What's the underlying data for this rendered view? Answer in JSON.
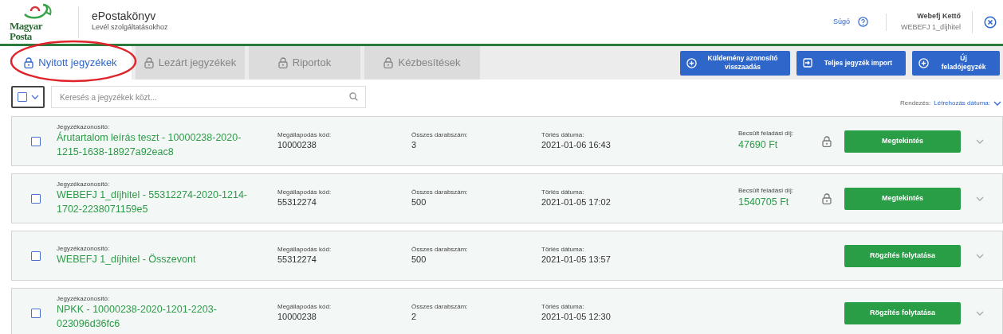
{
  "header": {
    "logo_text": "Magyar Posta",
    "app_title": "ePostakönyv",
    "app_subtitle": "Levél szolgáltatásokhoz",
    "help_label": "Súgó",
    "user_name": "Webefj Kettő",
    "user_account": "WEBEFJ 1_díjhitel"
  },
  "tabs": [
    {
      "label": "Nyitott jegyzékek",
      "selected": true,
      "disabled": false
    },
    {
      "label": "Lezárt jegyzékek",
      "selected": false,
      "disabled": true
    },
    {
      "label": "Riportok",
      "selected": false,
      "disabled": true
    },
    {
      "label": "Kézbesítések",
      "selected": false,
      "disabled": true
    }
  ],
  "actions": [
    {
      "label": "Küldemény azonosító visszaadás",
      "kind": "add"
    },
    {
      "label": "Teljes jegyzék import",
      "kind": "import"
    },
    {
      "label": "Új feladójegyzék",
      "kind": "add"
    }
  ],
  "toolbar": {
    "select_all_checked": false,
    "search_placeholder": "Keresés a jegyzékek közt...",
    "sort_label": "Rendezés:",
    "sort_value": "Létrehozás dátuma:"
  },
  "rows": [
    {
      "checked": false,
      "id_label": "Jegyzékazonosító:",
      "id": "Árutartalom leírás teszt - 10000238-2020-1215-1638-18927a92eac8",
      "code_label": "Megállapodás kód:",
      "code": "10000238",
      "count_label": "Összes darabszám:",
      "count": "3",
      "date_label": "Törlés dátuma:",
      "date": "2021-01-06 16:43",
      "fee_label": "Becsült feladási díj:",
      "fee": "47690 Ft",
      "locked": true,
      "button": "Megtekintés"
    },
    {
      "checked": false,
      "id_label": "Jegyzékazonosító:",
      "id": "WEBEFJ 1_díjhitel - 55312274-2020-1214-1702-2238071159e5",
      "code_label": "Megállapodás kód:",
      "code": "55312274",
      "count_label": "Összes darabszám:",
      "count": "500",
      "date_label": "Törlés dátuma:",
      "date": "2021-01-05 17:02",
      "fee_label": "Becsült feladási díj:",
      "fee": "1540705 Ft",
      "locked": true,
      "button": "Megtekintés"
    },
    {
      "checked": false,
      "id_label": "Jegyzékazonosító:",
      "id": "WEBEFJ 1_díjhitel - Összevont",
      "code_label": "Megállapodás kód:",
      "code": "55312274",
      "count_label": "Összes darabszám:",
      "count": "500",
      "date_label": "Törlés dátuma:",
      "date": "2021-01-05 13:57",
      "locked": false,
      "button": "Rögzítés folytatása"
    },
    {
      "checked": false,
      "id_label": "Jegyzékazonosító:",
      "id": "NPKK - 10000238-2020-1201-2203-023096d36fc6",
      "code_label": "Megállapodás kód:",
      "code": "10000238",
      "count_label": "Összes darabszám:",
      "count": "2",
      "date_label": "Törlés dátuma:",
      "date": "2021-01-05 12:30",
      "locked": false,
      "button": "Rögzítés folytatása"
    }
  ]
}
